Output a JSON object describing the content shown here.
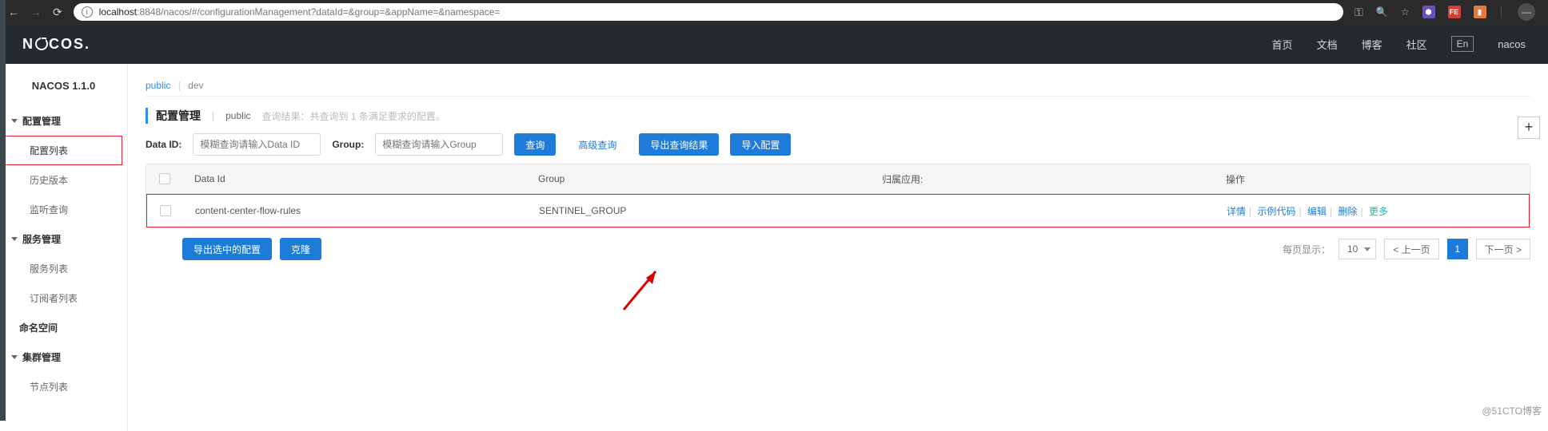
{
  "browser": {
    "url_host": "localhost",
    "url_port": ":8848",
    "url_path": "/nacos/#/configurationManagement?dataId=&group=&appName=&namespace="
  },
  "header": {
    "logo_text_left": "N",
    "logo_text_right": "COS.",
    "nav": {
      "home": "首页",
      "docs": "文档",
      "blog": "博客",
      "community": "社区",
      "lang": "En",
      "user": "nacos"
    }
  },
  "sidebar": {
    "title": "NACOS 1.1.0",
    "groups": [
      {
        "label": "配置管理",
        "items": [
          "配置列表",
          "历史版本",
          "监听查询"
        ],
        "active_index": 0
      },
      {
        "label": "服务管理",
        "items": [
          "服务列表",
          "订阅者列表"
        ]
      },
      {
        "label": "命名空间",
        "items": []
      },
      {
        "label": "集群管理",
        "items": [
          "节点列表"
        ]
      }
    ]
  },
  "namespace_tabs": {
    "active": "public",
    "other": "dev"
  },
  "page": {
    "title": "配置管理",
    "ns": "public",
    "hint": "查询结果：共查询到 1 条满足要求的配置。"
  },
  "filters": {
    "dataid_label": "Data ID:",
    "dataid_placeholder": "模糊查询请输入Data ID",
    "group_label": "Group:",
    "group_placeholder": "模糊查询请输入Group",
    "search_btn": "查询",
    "adv_search": "高级查询",
    "export_btn": "导出查询结果",
    "import_btn": "导入配置"
  },
  "table": {
    "headers": {
      "dataid": "Data Id",
      "group": "Group",
      "app": "归属应用:",
      "ops": "操作"
    },
    "rows": [
      {
        "dataid": "content-center-flow-rules",
        "group": "SENTINEL_GROUP",
        "app": ""
      }
    ],
    "ops": {
      "detail": "详情",
      "sample": "示例代码",
      "edit": "编辑",
      "delete": "删除",
      "more": "更多"
    }
  },
  "under": {
    "export_selected": "导出选中的配置",
    "clone": "克隆"
  },
  "pager": {
    "per_page_label": "每页显示：",
    "per_page_value": "10",
    "prev": "< 上一页",
    "current": "1",
    "next": "下一页 >"
  },
  "watermark": "@51CTO博客"
}
